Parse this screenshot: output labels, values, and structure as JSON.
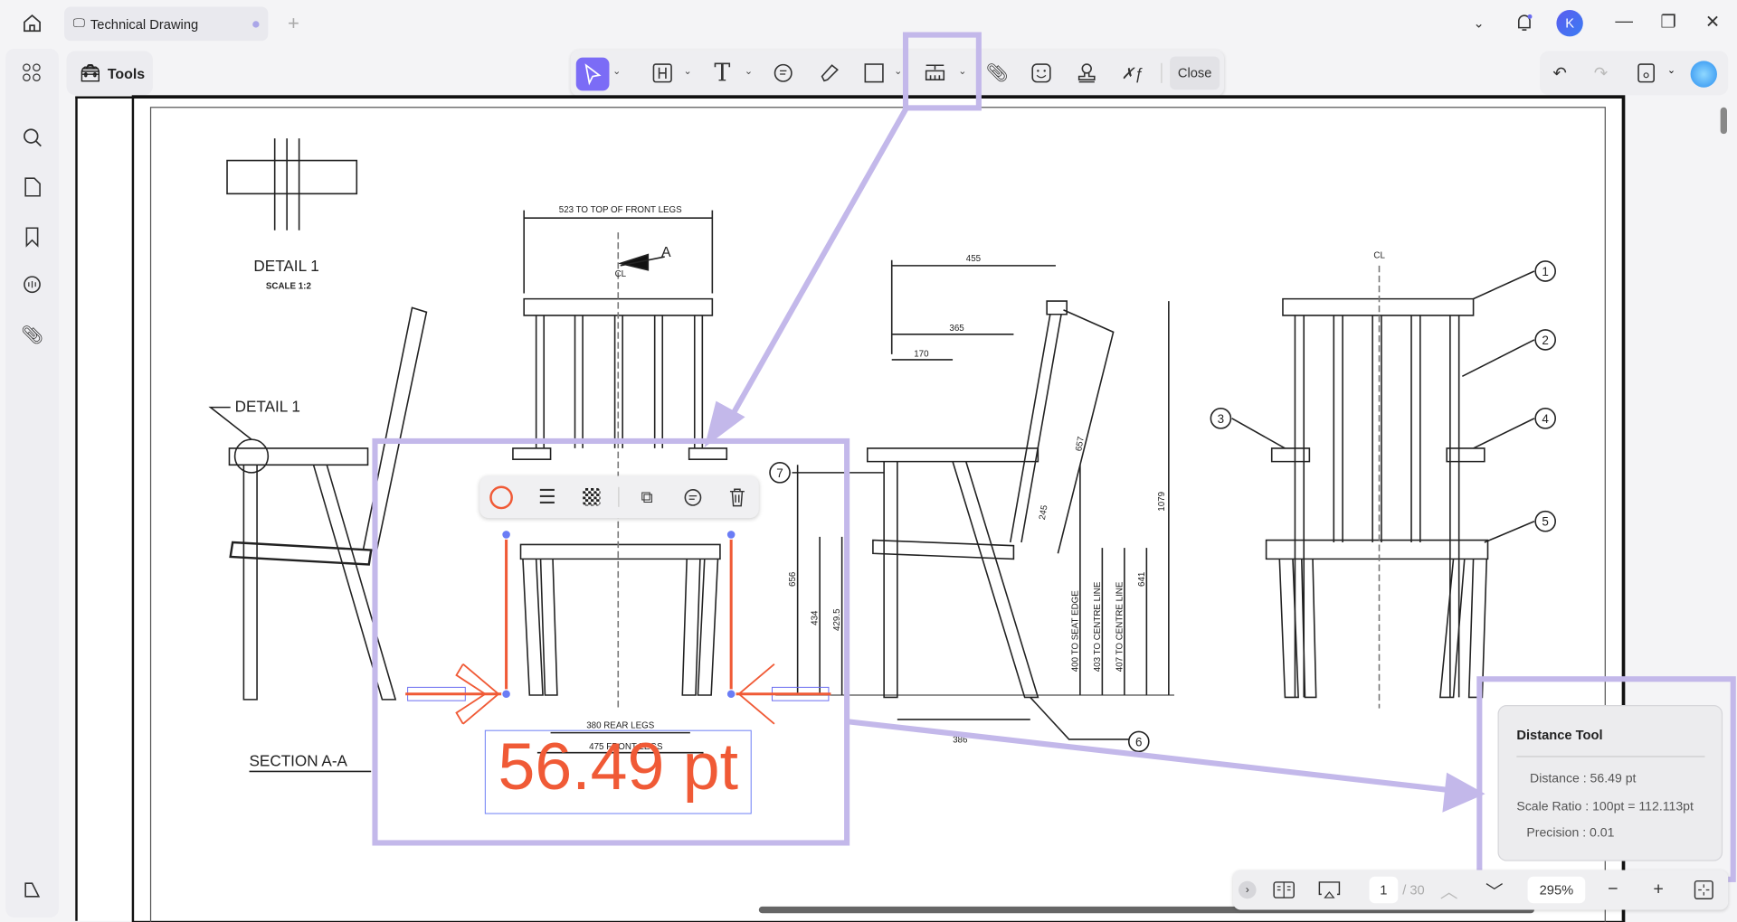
{
  "tab": {
    "title": "Technical Drawing"
  },
  "toolbar": {
    "tools_label": "Tools",
    "close_label": "Close"
  },
  "annotation": {
    "measurement": "56.49 pt",
    "color": "#f05a36"
  },
  "drawing": {
    "detail_title": "DETAIL 1",
    "detail_scale": "SCALE 1:2",
    "detail_callout": "DETAIL 1",
    "section": "SECTION A-A",
    "front_dim": "523 TO TOP OF FRONT LEGS",
    "section_mark": "A",
    "cl": "CL",
    "rear_legs": "380 REAR LEGS",
    "front_legs": "475 FRONT LEGS",
    "d455": "455",
    "d365": "365",
    "d170": "170",
    "d656": "656",
    "d434": "434",
    "d4295": "429.5",
    "d245": "245",
    "d657": "657",
    "d1079": "1079",
    "seat_edge": "400 TO SEAT EDGE",
    "centre403": "403 TO CENTRE LINE",
    "centre407": "407 TO CENTRE LINE",
    "d641": "641",
    "d386": "386",
    "callouts": [
      "1",
      "2",
      "3",
      "4",
      "5",
      "6",
      "7"
    ]
  },
  "distance_panel": {
    "title": "Distance Tool",
    "distance": "Distance : 56.49 pt",
    "scale": "Scale Ratio : 100pt = 112.113pt",
    "precision": "Precision : 0.01"
  },
  "bottom": {
    "page": "1",
    "total": "/ 30",
    "zoom": "295%"
  },
  "user": {
    "initial": "K"
  },
  "colors": {
    "accent": "#7b6cf6",
    "highlight": "#c3b8ea",
    "measure": "#f05a36"
  }
}
